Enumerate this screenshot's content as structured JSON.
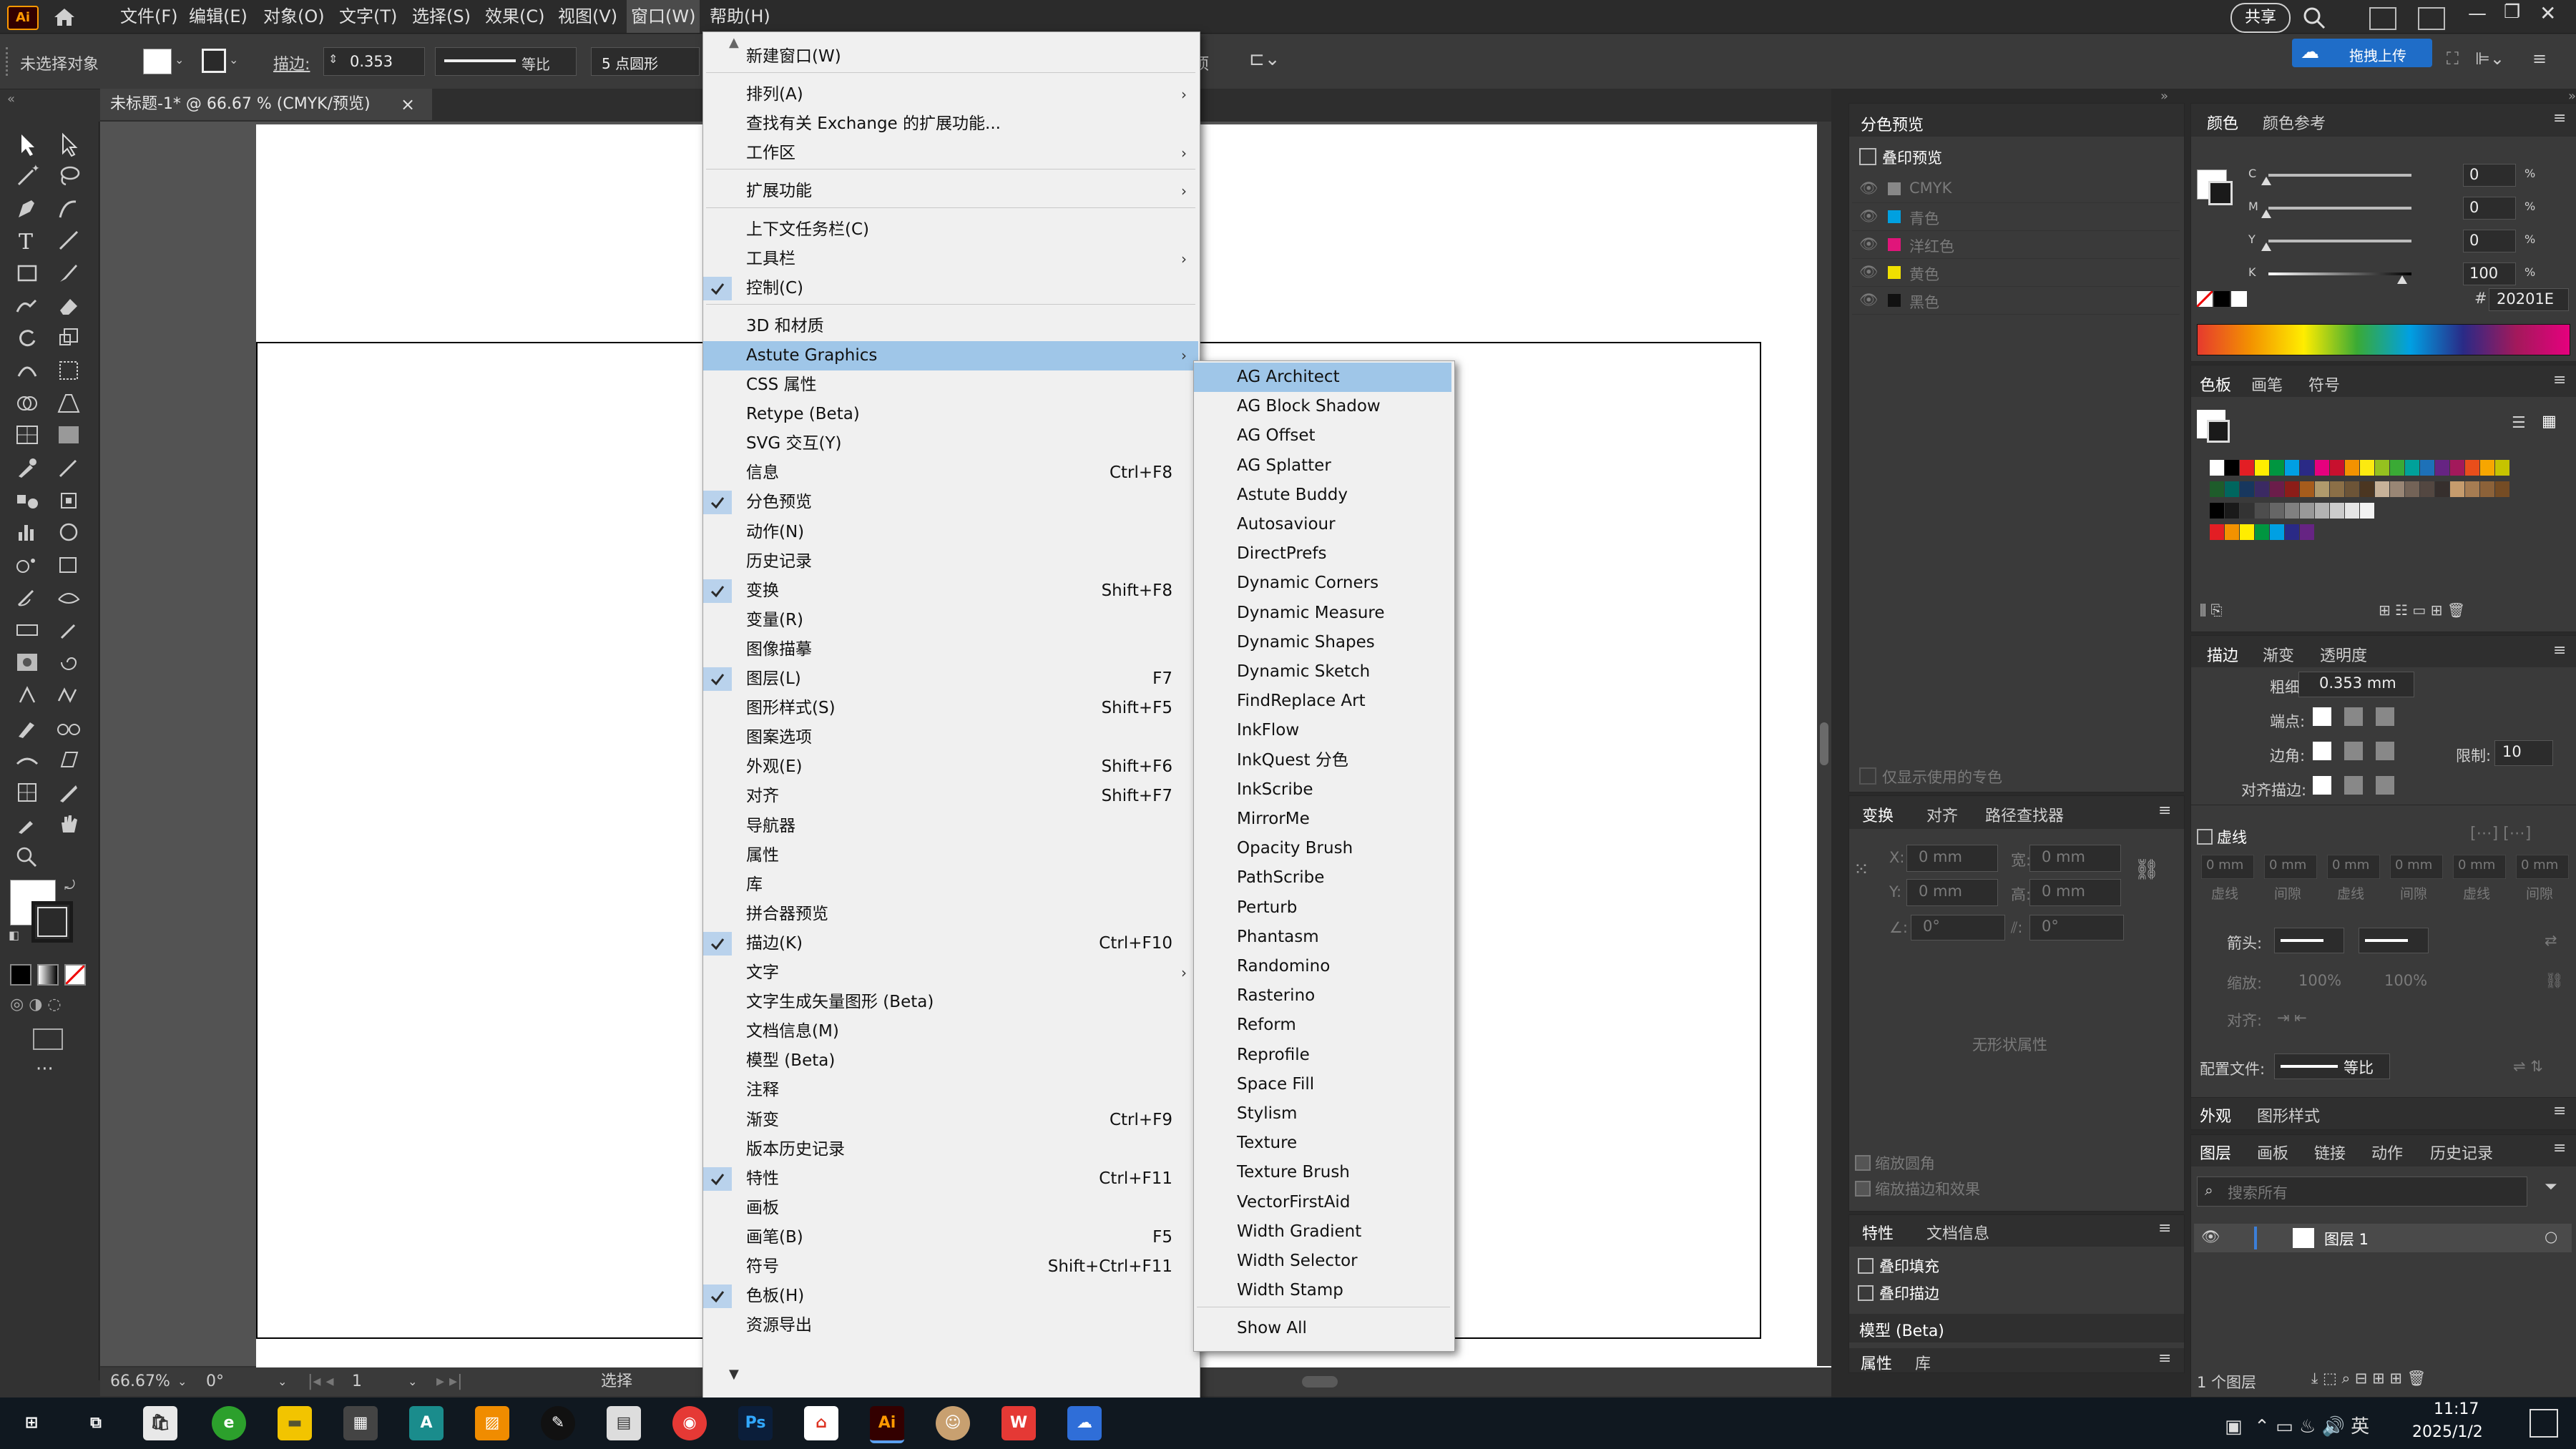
{
  "menubar": {
    "items": [
      "文件(F)",
      "编辑(E)",
      "对象(O)",
      "文字(T)",
      "选择(S)",
      "效果(C)",
      "视图(V)",
      "窗口(W)",
      "帮助(H)"
    ],
    "share_label": "共享",
    "upload_label": "拖拽上传"
  },
  "controlbar": {
    "selection_label": "未选择对象",
    "stroke_label": "描边:",
    "stroke_value": "0.353",
    "profile_label": "等比",
    "brush_label": "5 点圆形",
    "truncated_label": "项"
  },
  "document": {
    "tab_title": "未标题-1* @ 66.67 % (CMYK/预览)",
    "tab_close": "×"
  },
  "statusbar": {
    "zoom": "66.67%",
    "rotation": "0°",
    "artboard_num": "1",
    "tool_label": "选择"
  },
  "window_menu": {
    "items": [
      {
        "label": "新建窗口(W)",
        "shortcut": "",
        "checked": false,
        "submenu": false
      },
      {
        "label": "排列(A)",
        "shortcut": "",
        "checked": false,
        "submenu": true
      },
      {
        "label": "查找有关 Exchange 的扩展功能...",
        "shortcut": "",
        "checked": false,
        "submenu": false
      },
      {
        "label": "工作区",
        "shortcut": "",
        "checked": false,
        "submenu": true
      },
      {
        "label": "扩展功能",
        "shortcut": "",
        "checked": false,
        "submenu": true
      },
      {
        "label": "上下文任务栏(C)",
        "shortcut": "",
        "checked": false,
        "submenu": false
      },
      {
        "label": "工具栏",
        "shortcut": "",
        "checked": false,
        "submenu": true
      },
      {
        "label": "控制(C)",
        "shortcut": "",
        "checked": true,
        "submenu": false
      },
      {
        "label": "3D 和材质",
        "shortcut": "",
        "checked": false,
        "submenu": false
      },
      {
        "label": "Astute Graphics",
        "shortcut": "",
        "checked": false,
        "submenu": true
      },
      {
        "label": "CSS 属性",
        "shortcut": "",
        "checked": false,
        "submenu": false
      },
      {
        "label": "Retype (Beta)",
        "shortcut": "",
        "checked": false,
        "submenu": false
      },
      {
        "label": "SVG 交互(Y)",
        "shortcut": "",
        "checked": false,
        "submenu": false
      },
      {
        "label": "信息",
        "shortcut": "Ctrl+F8",
        "checked": false,
        "submenu": false
      },
      {
        "label": "分色预览",
        "shortcut": "",
        "checked": true,
        "submenu": false
      },
      {
        "label": "动作(N)",
        "shortcut": "",
        "checked": false,
        "submenu": false
      },
      {
        "label": "历史记录",
        "shortcut": "",
        "checked": false,
        "submenu": false
      },
      {
        "label": "变换",
        "shortcut": "Shift+F8",
        "checked": true,
        "submenu": false
      },
      {
        "label": "变量(R)",
        "shortcut": "",
        "checked": false,
        "submenu": false
      },
      {
        "label": "图像描摹",
        "shortcut": "",
        "checked": false,
        "submenu": false
      },
      {
        "label": "图层(L)",
        "shortcut": "F7",
        "checked": true,
        "submenu": false
      },
      {
        "label": "图形样式(S)",
        "shortcut": "Shift+F5",
        "checked": false,
        "submenu": false
      },
      {
        "label": "图案选项",
        "shortcut": "",
        "checked": false,
        "submenu": false
      },
      {
        "label": "外观(E)",
        "shortcut": "Shift+F6",
        "checked": false,
        "submenu": false
      },
      {
        "label": "对齐",
        "shortcut": "Shift+F7",
        "checked": false,
        "submenu": false
      },
      {
        "label": "导航器",
        "shortcut": "",
        "checked": false,
        "submenu": false
      },
      {
        "label": "属性",
        "shortcut": "",
        "checked": false,
        "submenu": false
      },
      {
        "label": "库",
        "shortcut": "",
        "checked": false,
        "submenu": false
      },
      {
        "label": "拼合器预览",
        "shortcut": "",
        "checked": false,
        "submenu": false
      },
      {
        "label": "描边(K)",
        "shortcut": "Ctrl+F10",
        "checked": true,
        "submenu": false
      },
      {
        "label": "文字",
        "shortcut": "",
        "checked": false,
        "submenu": true
      },
      {
        "label": "文字生成矢量图形 (Beta)",
        "shortcut": "",
        "checked": false,
        "submenu": false
      },
      {
        "label": "文档信息(M)",
        "shortcut": "",
        "checked": false,
        "submenu": false
      },
      {
        "label": "模型 (Beta)",
        "shortcut": "",
        "checked": false,
        "submenu": false
      },
      {
        "label": "注释",
        "shortcut": "",
        "checked": false,
        "submenu": false
      },
      {
        "label": "渐变",
        "shortcut": "Ctrl+F9",
        "checked": false,
        "submenu": false
      },
      {
        "label": "版本历史记录",
        "shortcut": "",
        "checked": false,
        "submenu": false
      },
      {
        "label": "特性",
        "shortcut": "Ctrl+F11",
        "checked": true,
        "submenu": false
      },
      {
        "label": "画板",
        "shortcut": "",
        "checked": false,
        "submenu": false
      },
      {
        "label": "画笔(B)",
        "shortcut": "F5",
        "checked": false,
        "submenu": false
      },
      {
        "label": "符号",
        "shortcut": "Shift+Ctrl+F11",
        "checked": false,
        "submenu": false
      },
      {
        "label": "色板(H)",
        "shortcut": "",
        "checked": true,
        "submenu": false
      },
      {
        "label": "资源导出",
        "shortcut": "",
        "checked": false,
        "submenu": false
      }
    ]
  },
  "astute_submenu": {
    "items": [
      "AG Architect",
      "AG Block Shadow",
      "AG Offset",
      "AG Splatter",
      "Astute Buddy",
      "Autosaviour",
      "DirectPrefs",
      "Dynamic Corners",
      "Dynamic Measure",
      "Dynamic Shapes",
      "Dynamic Sketch",
      "FindReplace Art",
      "InkFlow",
      "InkQuest 分色",
      "InkScribe",
      "MirrorMe",
      "Opacity Brush",
      "PathScribe",
      "Perturb",
      "Phantasm",
      "Randomino",
      "Rasterino",
      "Reform",
      "Reprofile",
      "Space Fill",
      "Stylism",
      "Texture",
      "Texture Brush",
      "VectorFirstAid",
      "Width Gradient",
      "Width Selector",
      "Width Stamp"
    ],
    "show_all": "Show All"
  },
  "separations_panel": {
    "tab": "分色预览",
    "overprint_label": "叠印预览",
    "inks": [
      "CMYK",
      "青色",
      "洋红色",
      "黄色",
      "黑色"
    ],
    "ink_colors": [
      "#888888",
      "#00a0e0",
      "#e0157a",
      "#f0e000",
      "#111111"
    ],
    "spot_only_label": "仅显示使用的专色"
  },
  "transform_panel": {
    "tabs": [
      "变换",
      "对齐",
      "路径查找器"
    ],
    "x_label": "X:",
    "y_label": "Y:",
    "w_label": "宽:",
    "h_label": "高:",
    "x_value": "0 mm",
    "y_value": "0 mm",
    "w_value": "0 mm",
    "h_value": "0 mm",
    "angle_value": "0°",
    "shear_value": "0°",
    "no_props": "无形状属性",
    "scale_corners": "缩放圆角",
    "scale_strokes": "缩放描边和效果"
  },
  "attributes_panel": {
    "tabs": [
      "特性",
      "文档信息"
    ],
    "overprint_fill": "叠印填充",
    "overprint_stroke": "叠印描边",
    "model_tab": "模型 (Beta)",
    "bottom_tabs": [
      "属性",
      "库"
    ]
  },
  "color_panel": {
    "tabs": [
      "颜色",
      "颜色参考"
    ],
    "channels": [
      {
        "label": "C",
        "value": "0",
        "unit": "%",
        "fraction": 0
      },
      {
        "label": "M",
        "value": "0",
        "unit": "%",
        "fraction": 0
      },
      {
        "label": "Y",
        "value": "0",
        "unit": "%",
        "fraction": 0
      },
      {
        "label": "K",
        "value": "100",
        "unit": "%",
        "fraction": 1
      }
    ],
    "hex_label": "#",
    "hex_value": "20201E"
  },
  "swatches_panel": {
    "tabs": [
      "色板",
      "画笔",
      "符号"
    ],
    "row1": [
      "#ffffff",
      "#000000",
      "#e31e24",
      "#ffed00",
      "#009640",
      "#00a0e3",
      "#2a2a86",
      "#e6007e",
      "#c8102e",
      "#f39200",
      "#fcea10",
      "#95c11f",
      "#3aaa35",
      "#00a19a",
      "#1d71b8",
      "#662483",
      "#a3195b",
      "#e94e1b",
      "#f7a600",
      "#c6c300"
    ],
    "row2": [
      "#1e5c2b",
      "#00665e",
      "#17375e",
      "#3b2a63",
      "#6b1d4a",
      "#8c1d18",
      "#a65c1c",
      "#b09a6c",
      "#8b6f47",
      "#6c5437",
      "#4b3621",
      "#c7b299",
      "#998675",
      "#736357",
      "#534741",
      "#362f2d",
      "#c69c6d",
      "#a67c52",
      "#8c6239",
      "#754c24"
    ],
    "row3": [
      "#000000",
      "#1a1a1a",
      "#333333",
      "#4d4d4d",
      "#666666",
      "#808080",
      "#999999",
      "#b3b3b3",
      "#cccccc",
      "#e6e6e6",
      "#f2f2f2"
    ],
    "row4": [
      "#e31e24",
      "#f39200",
      "#ffed00",
      "#009640",
      "#00a0e3",
      "#2a2a86",
      "#662483"
    ]
  },
  "stroke_panel": {
    "tabs": [
      "描边",
      "渐变",
      "透明度"
    ],
    "weight_label": "粗细:",
    "weight_value": "0.353 mm",
    "cap_label": "端点:",
    "corner_label": "边角:",
    "limit_label": "限制:",
    "limit_value": "10",
    "align_label": "对齐描边:",
    "dashed_label": "虚线",
    "dash_labels": [
      "虚线",
      "间隙",
      "虚线",
      "间隙",
      "虚线",
      "间隙"
    ],
    "dash_value": "0 mm",
    "arrow_label": "箭头:",
    "scale_label": "缩放:",
    "scale_value": "100%",
    "align_arrow_label": "对齐:",
    "profile_label": "配置文件:",
    "profile_value": "等比"
  },
  "appearance_panel": {
    "tabs": [
      "外观",
      "图形样式"
    ]
  },
  "layers_panel": {
    "tabs": [
      "图层",
      "画板",
      "链接",
      "动作",
      "历史记录"
    ],
    "search_placeholder": "搜索所有",
    "layer_name": "图层 1",
    "count_label": "1 个图层"
  },
  "taskbar": {
    "time": "11:17",
    "date": "2025/1/2"
  }
}
